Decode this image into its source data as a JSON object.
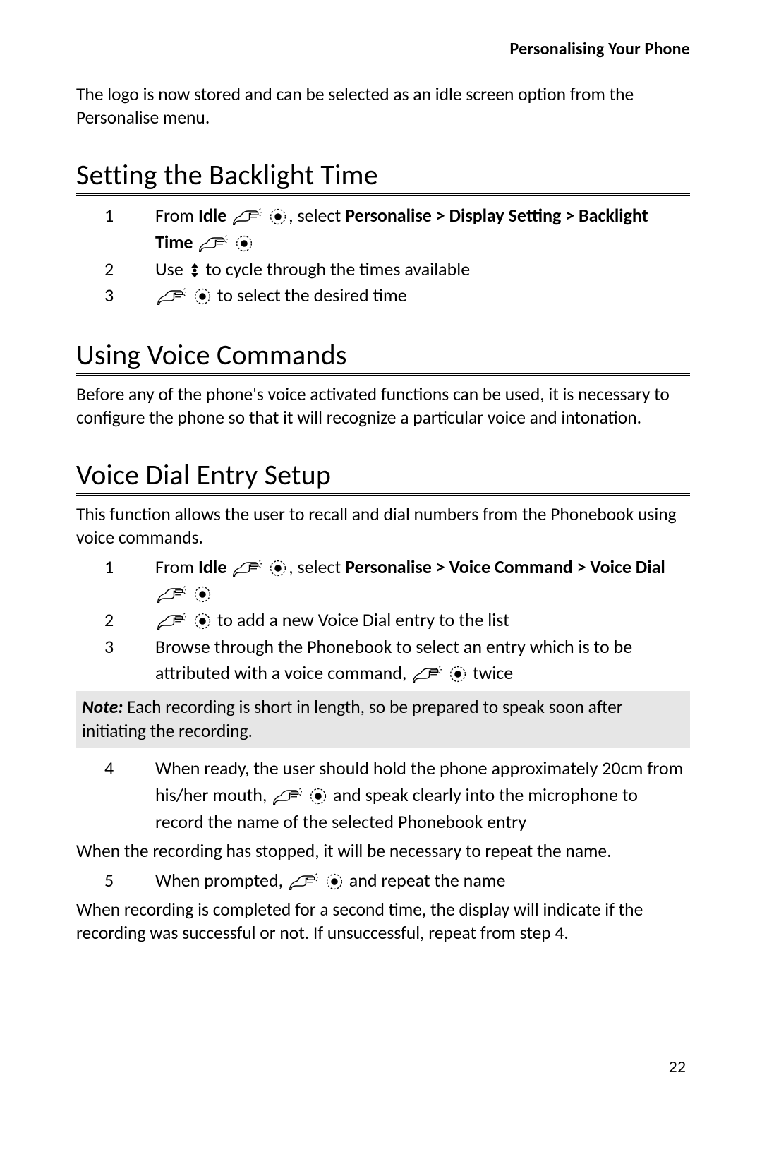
{
  "header": {
    "running_head": "Personalising Your Phone"
  },
  "intro": "The logo is now stored and can be selected as an idle screen option from the Personalise menu.",
  "sections": {
    "backlight": {
      "title": "Setting the Backlight Time",
      "steps": [
        {
          "num": "1",
          "from": "From ",
          "idle": "Idle",
          "select": ", select ",
          "path": "Personalise > Display Setting > Backlight Time"
        },
        {
          "num": "2",
          "use": "Use ",
          "tail": " to cycle through the times available"
        },
        {
          "num": "3",
          "tail": " to select the desired time"
        }
      ]
    },
    "voice_commands": {
      "title": "Using Voice Commands",
      "body": "Before any of the phone's voice activated functions can be used, it is necessary to configure the phone so that it will recognize a particular voice and intonation."
    },
    "voice_dial": {
      "title": "Voice Dial Entry Setup",
      "body": "This function allows the user to recall and dial numbers from the Phonebook using voice commands.",
      "steps_a": [
        {
          "num": "1",
          "from": "From ",
          "idle": "Idle",
          "select": ", select ",
          "path": "Personalise > Voice Command > Voice Dial"
        },
        {
          "num": "2",
          "tail": " to add a new Voice Dial entry to the list"
        },
        {
          "num": "3",
          "pre": "Browse through the Phonebook to select an entry which is to be attributed with a voice command, ",
          "tail": " twice"
        }
      ],
      "note_label": "Note:",
      "note_body": " Each recording is short in length, so be prepared to speak soon after initiating the recording.",
      "steps_b": [
        {
          "num": "4",
          "pre": "When ready, the user should hold the phone approximately 20cm from his/her mouth, ",
          "tail": " and speak clearly into the microphone to record the name of the selected Phonebook entry"
        }
      ],
      "after_b": "When the recording has stopped, it will be necessary to repeat the name.",
      "steps_c": [
        {
          "num": "5",
          "pre": "When prompted, ",
          "tail": " and repeat the name"
        }
      ],
      "after_c": "When recording is completed for a second time, the display will indicate if the recording was successful or not. If unsuccessful, repeat from step 4."
    }
  },
  "page_number": "22",
  "icons": {
    "hand": "press-key-hand-icon",
    "nav_select": "nav-select-icon",
    "nav_updown": "nav-updown-icon"
  }
}
